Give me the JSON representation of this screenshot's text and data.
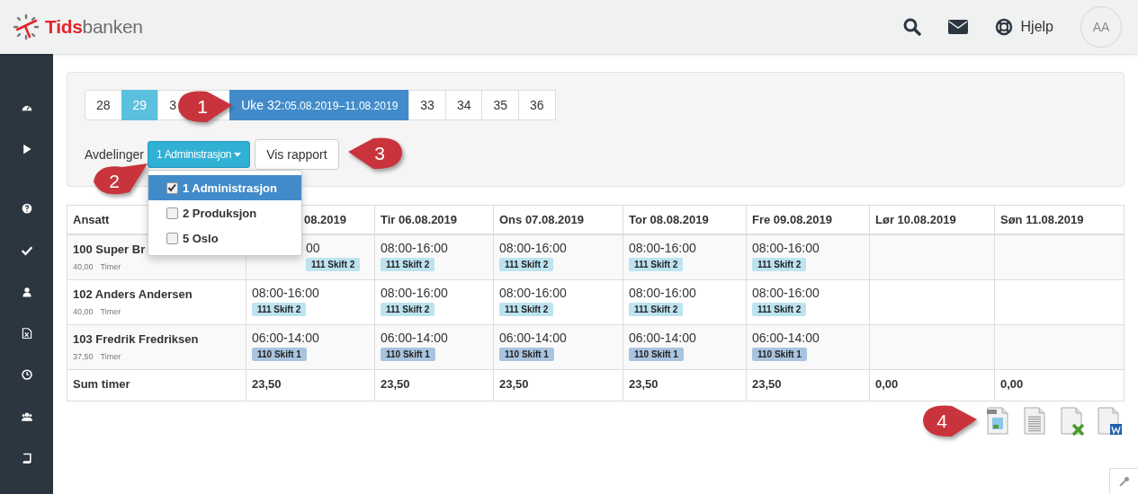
{
  "header": {
    "brand_red": "Tids",
    "brand_grey": "banken",
    "help": "Hjelp",
    "avatar": "AA"
  },
  "weeks": [
    {
      "label": "28",
      "selected": false,
      "hovered": false
    },
    {
      "label": "29",
      "selected": false,
      "hovered": true
    },
    {
      "label": "3",
      "selected": false,
      "hovered": false
    },
    {
      "label": "Uke 32:",
      "range": "05.08.2019–11.08.2019",
      "selected": true,
      "hovered": false
    },
    {
      "label": "33",
      "selected": false,
      "hovered": false
    },
    {
      "label": "34",
      "selected": false,
      "hovered": false
    },
    {
      "label": "35",
      "selected": false,
      "hovered": false
    },
    {
      "label": "36",
      "selected": false,
      "hovered": false
    }
  ],
  "filter": {
    "label": "Avdelinger",
    "dropdown": "1 Administrasjon",
    "report_button": "Vis rapport",
    "options": [
      {
        "label": "1 Administrasjon",
        "checked": true,
        "selected": true
      },
      {
        "label": "2 Produksjon",
        "checked": false,
        "selected": false
      },
      {
        "label": "5 Oslo",
        "checked": false,
        "selected": false
      }
    ]
  },
  "table": {
    "columns": [
      "Ansatt",
      "08.2019",
      "Tir 06.08.2019",
      "Ons 07.08.2019",
      "Tor 08.08.2019",
      "Fre 09.08.2019",
      "Lør 10.08.2019",
      "Søn 11.08.2019"
    ],
    "rows": [
      {
        "name": "100 Super Br",
        "hours": "40,00",
        "unit": "Timer",
        "days": [
          {
            "time": "00",
            "shift": "111 Skift 2",
            "color": "#bde3f0"
          },
          {
            "time": "08:00-16:00",
            "shift": "111 Skift 2",
            "color": "#bde3f0"
          },
          {
            "time": "08:00-16:00",
            "shift": "111 Skift 2",
            "color": "#bde3f0"
          },
          {
            "time": "08:00-16:00",
            "shift": "111 Skift 2",
            "color": "#bde3f0"
          },
          {
            "time": "08:00-16:00",
            "shift": "111 Skift 2",
            "color": "#bde3f0"
          }
        ]
      },
      {
        "name": "102 Anders Andersen",
        "hours": "40,00",
        "unit": "Timer",
        "days": [
          {
            "time": "08:00-16:00",
            "shift": "111 Skift 2",
            "color": "#bde3f0"
          },
          {
            "time": "08:00-16:00",
            "shift": "111 Skift 2",
            "color": "#bde3f0"
          },
          {
            "time": "08:00-16:00",
            "shift": "111 Skift 2",
            "color": "#bde3f0"
          },
          {
            "time": "08:00-16:00",
            "shift": "111 Skift 2",
            "color": "#bde3f0"
          },
          {
            "time": "08:00-16:00",
            "shift": "111 Skift 2",
            "color": "#bde3f0"
          }
        ]
      },
      {
        "name": "103 Fredrik Fredriksen",
        "hours": "37,50",
        "unit": "Timer",
        "days": [
          {
            "time": "06:00-14:00",
            "shift": "110 Skift 1",
            "color": "#a9c4e0"
          },
          {
            "time": "06:00-14:00",
            "shift": "110 Skift 1",
            "color": "#a9c4e0"
          },
          {
            "time": "06:00-14:00",
            "shift": "110 Skift 1",
            "color": "#a9c4e0"
          },
          {
            "time": "06:00-14:00",
            "shift": "110 Skift 1",
            "color": "#a9c4e0"
          },
          {
            "time": "06:00-14:00",
            "shift": "110 Skift 1",
            "color": "#a9c4e0"
          }
        ]
      }
    ],
    "totals": [
      "Sum timer",
      "23,50",
      "23,50",
      "23,50",
      "23,50",
      "23,50",
      "0,00",
      "0,00"
    ]
  },
  "markers": [
    "1",
    "2",
    "3",
    "4"
  ]
}
